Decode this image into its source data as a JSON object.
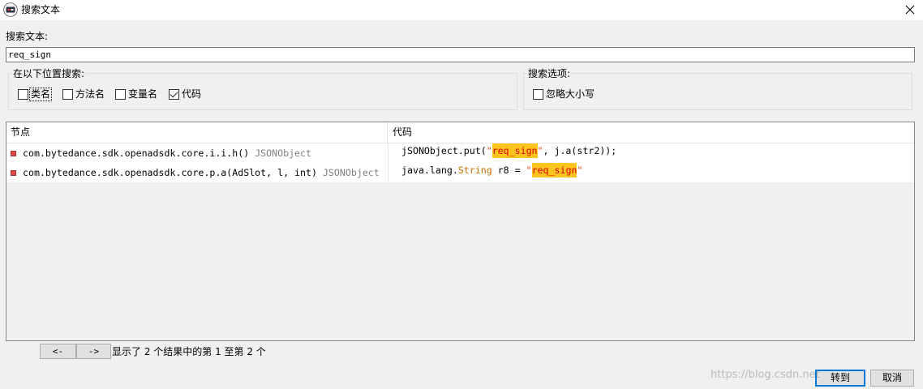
{
  "window": {
    "title": "搜索文本"
  },
  "search": {
    "label": "搜索文本:",
    "value": "req_sign"
  },
  "search_in": {
    "title": "在以下位置搜索:",
    "options": [
      {
        "label": "类名",
        "checked": false
      },
      {
        "label": "方法名",
        "checked": false
      },
      {
        "label": "变量名",
        "checked": false
      },
      {
        "label": "代码",
        "checked": true
      }
    ]
  },
  "search_options": {
    "title": "搜索选项:",
    "options": [
      {
        "label": "忽略大小写",
        "checked": false
      }
    ]
  },
  "results": {
    "columns": [
      "节点",
      "代码"
    ],
    "rows": [
      {
        "node": "com.bytedance.sdk.openadsdk.core.i.i.h()",
        "node_type": "JSONObject",
        "code": [
          "jSONObject.put(",
          "\"",
          "req_sign",
          "\"",
          ", j.a(str2));"
        ]
      },
      {
        "node": "com.bytedance.sdk.openadsdk.core.p.a(AdSlot, l, int)",
        "node_type": "JSONObject",
        "code": [
          "java.lang.",
          "String",
          " r8 = ",
          "\"",
          "req_sign",
          "\""
        ]
      }
    ]
  },
  "pager": {
    "prev_label": "<-",
    "next_label": "->",
    "status": "显示了 2 个结果中的第 1 至第 2 个"
  },
  "footer": {
    "goto_label": "转到",
    "cancel_label": "取消"
  },
  "watermark": "https://blog.csdn.net",
  "icons": {
    "app": "jadx-app-icon",
    "close": "close-icon",
    "result_node": "method-node-icon"
  },
  "colors": {
    "window_bg": "#f0f0f0",
    "match_bg": "#ffc51e",
    "match_text": "#d80000",
    "string_text": "#e0480f",
    "type_text": "#c07000",
    "node_type_text": "#808080",
    "node_icon": "#dd4b4b",
    "default_button_border": "#0078d7"
  }
}
